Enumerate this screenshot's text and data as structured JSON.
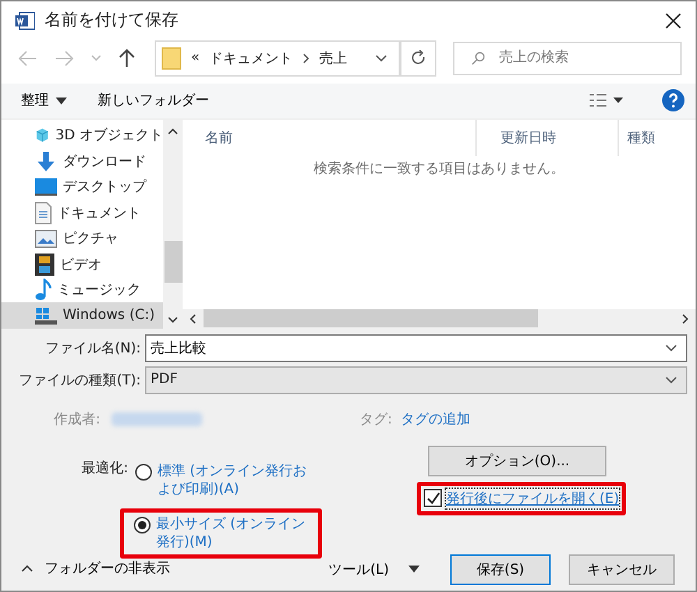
{
  "window": {
    "title": "名前を付けて保存"
  },
  "nav": {
    "breadcrumb_prefix": "«",
    "path": [
      "ドキュメント",
      "売上"
    ],
    "search": {
      "placeholder": "売上の検索"
    }
  },
  "toolbar": {
    "organize": "整理",
    "new_folder": "新しいフォルダー"
  },
  "sidebar": {
    "items": [
      {
        "label": "3D オブジェクト",
        "kind": "cube",
        "selected": false
      },
      {
        "label": "ダウンロード",
        "kind": "download",
        "selected": false
      },
      {
        "label": "デスクトップ",
        "kind": "desktop",
        "selected": false
      },
      {
        "label": "ドキュメント",
        "kind": "document",
        "selected": false
      },
      {
        "label": "ピクチャ",
        "kind": "pictures",
        "selected": false
      },
      {
        "label": "ビデオ",
        "kind": "video",
        "selected": false
      },
      {
        "label": "ミュージック",
        "kind": "music",
        "selected": false
      },
      {
        "label": "Windows (C:)",
        "kind": "drive",
        "selected": true
      }
    ]
  },
  "file_list": {
    "columns": [
      "名前",
      "更新日時",
      "種類"
    ],
    "empty_message": "検索条件に一致する項目はありません。"
  },
  "form": {
    "file_name": {
      "label": "ファイル名(N):",
      "value": "売上比較"
    },
    "file_type": {
      "label": "ファイルの種類(T):",
      "value": "PDF"
    },
    "author_label": "作成者:",
    "tags_label": "タグ:",
    "tags_link": "タグの追加",
    "optimize_label": "最適化:",
    "optimize_options": [
      {
        "label": "標準 (オンライン発行および印刷)(A)",
        "selected": false,
        "highlighted": false
      },
      {
        "label": "最小サイズ (オンライン発行)(M)",
        "selected": true,
        "highlighted": true
      }
    ],
    "options_button": "オプション(O)...",
    "open_after": {
      "label": "発行後にファイルを開く(E)",
      "checked": true,
      "highlighted": true
    }
  },
  "footer": {
    "hide_folders": "フォルダーの非表示",
    "tools": "ツール(L)",
    "save": "保存(S)",
    "cancel": "キャンセル"
  }
}
